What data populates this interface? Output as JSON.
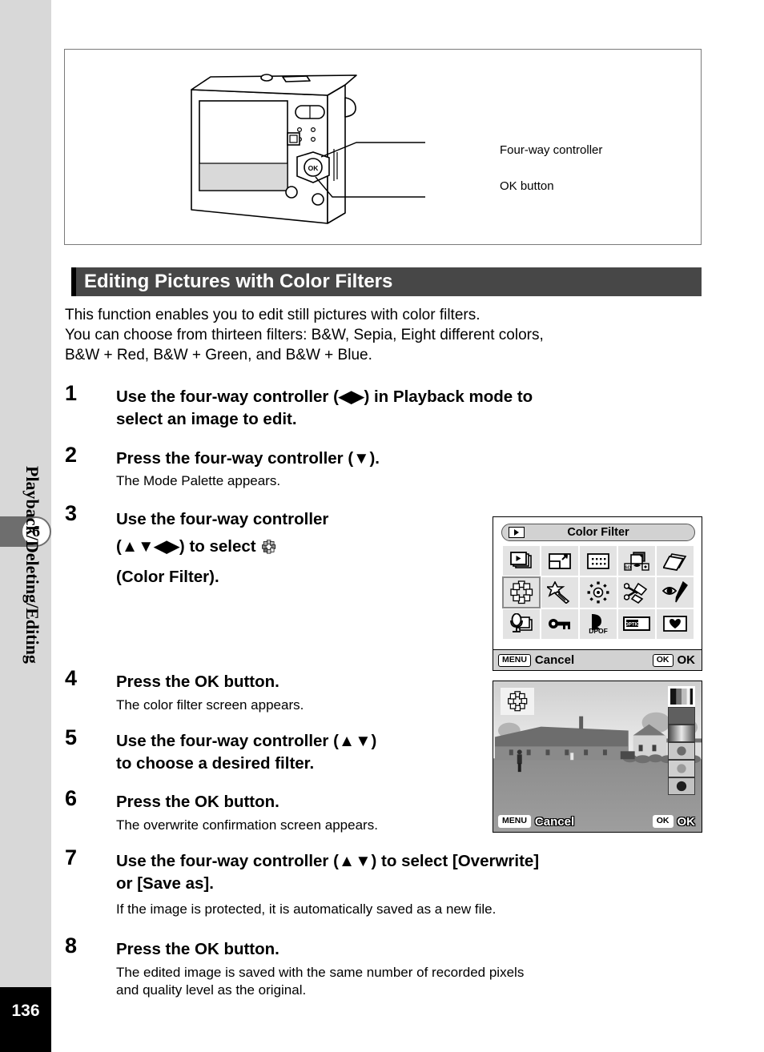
{
  "sidebar": {
    "chapter_number": "6",
    "chapter_title": "Playback/Deleting/Editing",
    "page_number": "136"
  },
  "illustration": {
    "callouts": [
      {
        "label": "Four-way controller"
      },
      {
        "label": "OK button"
      }
    ]
  },
  "section": {
    "heading": "Editing Pictures with Color Filters",
    "intro_lines": [
      "This function enables you to edit still pictures with color filters.",
      "You can choose from thirteen filters: B&W, Sepia, Eight different colors,",
      "B&W + Red, B&W + Green, and B&W + Blue."
    ]
  },
  "steps": [
    {
      "number": "1",
      "lines": [
        "Use the four-way controller (◀▶) in Playback mode to",
        "select an image to edit."
      ],
      "note": ""
    },
    {
      "number": "2",
      "lines": [
        "Press the four-way controller (▼)."
      ],
      "note": "The Mode Palette appears."
    },
    {
      "number": "3",
      "lines": [
        "Use the four-way controller",
        "(▲▼◀▶) to select ",
        "(Color Filter)."
      ],
      "note": ""
    },
    {
      "number": "4",
      "lines": [
        "Press the OK button."
      ],
      "note": "The color filter screen appears."
    },
    {
      "number": "5",
      "lines": [
        "Use the four-way controller (▲▼)",
        "to choose a desired filter."
      ],
      "note": ""
    },
    {
      "number": "6",
      "lines": [
        "Press the OK button."
      ],
      "note": "The overwrite confirmation screen appears."
    },
    {
      "number": "7",
      "lines": [
        "Use the four-way controller (▲▼) to select [Overwrite]",
        "or [Save as]."
      ],
      "note": "If the image is protected, it is automatically saved as a new file."
    },
    {
      "number": "8",
      "lines": [
        "Press the OK button."
      ],
      "note_lines": [
        "The edited image is saved with the same number of recorded pixels",
        "and quality level as the original."
      ]
    }
  ],
  "mode_palette": {
    "title": "Color Filter",
    "cancel_key": "MENU",
    "cancel_label": "Cancel",
    "ok_key": "OK",
    "ok_label": "OK",
    "icons": [
      "slideshow-icon",
      "resize-icon",
      "image-crop-dotted-icon",
      "image-copy-icon",
      "rotate-icon",
      "color-filter-icon",
      "digital-filter-icon",
      "brightness-filter-icon",
      "trimming-scissors-icon",
      "red-eye-compensation-icon",
      "voice-memo-icon",
      "protect-key-icon",
      "dpof-icon",
      "startup-screen-icon",
      "favorite-heart-icon"
    ],
    "selected_icon": "color-filter-icon",
    "dpof_text": "DPOF",
    "optio_text": "OPTIO",
    "sd_text": "SD"
  },
  "filter_screen": {
    "icon": "color-filter-icon",
    "cancel_key": "MENU",
    "cancel_label": "Cancel",
    "ok_key": "OK",
    "ok_label": "OK",
    "filter_items": [
      "bw-selected-swatch",
      "dark-gray-swatch",
      "gradient-swatch",
      "dot-gray-swatch",
      "dot-lightgray-swatch",
      "dot-dark-swatch"
    ]
  },
  "colors": {
    "heading_bg": "#474747",
    "sidebar_bg": "#d8d8d8",
    "chapter_band": "#6e6e6e",
    "page_block": "#000000",
    "lcd_bar": "#d2d2d2",
    "cell_bg": "#e3e3e3"
  }
}
